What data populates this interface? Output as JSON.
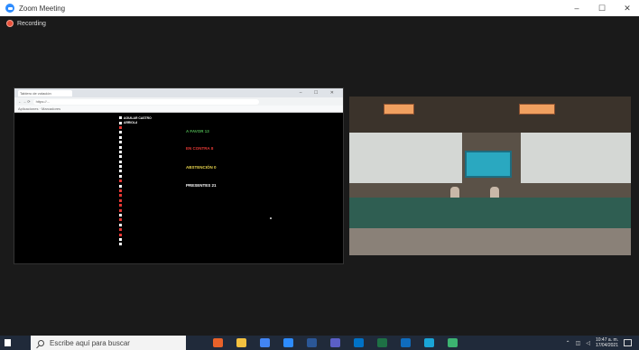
{
  "window": {
    "title": "Zoom Meeting",
    "controls": [
      "–",
      "☐",
      "✕"
    ]
  },
  "recording": {
    "label": "Recording"
  },
  "share": {
    "tab_label": "Tablero de votación",
    "address": "https://...",
    "bookmarks": "Aplicaciones  ·  Marcadores",
    "names": [
      {
        "text": "AGUILAR CASTRO",
        "color": "#ffffff"
      },
      {
        "text": "ARRIOLA",
        "color": "#ffffff"
      },
      {
        "text": "",
        "color": "#e53935"
      },
      {
        "text": "",
        "color": "#ffffff"
      },
      {
        "text": "",
        "color": "#ffffff"
      },
      {
        "text": "",
        "color": "#ffffff"
      },
      {
        "text": "",
        "color": "#ffffff"
      },
      {
        "text": "",
        "color": "#ffffff"
      },
      {
        "text": "",
        "color": "#ffffff"
      },
      {
        "text": "",
        "color": "#ffffff"
      },
      {
        "text": "",
        "color": "#ffffff"
      },
      {
        "text": "",
        "color": "#ffffff"
      },
      {
        "text": "",
        "color": "#ffffff"
      },
      {
        "text": "",
        "color": "#e53935"
      },
      {
        "text": "",
        "color": "#ffffff"
      },
      {
        "text": "",
        "color": "#e53935"
      },
      {
        "text": "",
        "color": "#e53935"
      },
      {
        "text": "",
        "color": "#e53935"
      },
      {
        "text": "",
        "color": "#e53935"
      },
      {
        "text": "",
        "color": "#e53935"
      },
      {
        "text": "",
        "color": "#ffffff"
      },
      {
        "text": "",
        "color": "#e53935"
      },
      {
        "text": "",
        "color": "#ffffff"
      },
      {
        "text": "",
        "color": "#e53935"
      },
      {
        "text": "",
        "color": "#e53935"
      },
      {
        "text": "",
        "color": "#ffffff"
      },
      {
        "text": "",
        "color": "#ffffff"
      }
    ],
    "tally": [
      {
        "label": "A FAVOR 13",
        "color": "#4caf50"
      },
      {
        "label": "EN CONTRA 8",
        "color": "#e53935"
      },
      {
        "label": "ABSTENCIÓN 0",
        "color": "#e8d44d"
      },
      {
        "label": "PRESENTES 21",
        "color": "#ffffff"
      }
    ]
  },
  "taskbar": {
    "search_placeholder": "Escribe aquí para buscar",
    "apps": [
      {
        "name": "firefox",
        "color": "#e8622a"
      },
      {
        "name": "file-explorer",
        "color": "#f3c140"
      },
      {
        "name": "chrome",
        "color": "#4285f4"
      },
      {
        "name": "zoom",
        "color": "#2d8cff"
      },
      {
        "name": "word",
        "color": "#2b5797"
      },
      {
        "name": "teams",
        "color": "#5b5fc7"
      },
      {
        "name": "outlook",
        "color": "#0072c6"
      },
      {
        "name": "excel",
        "color": "#1e7145"
      },
      {
        "name": "photos",
        "color": "#0f6cbd"
      },
      {
        "name": "edge",
        "color": "#1aa5d6"
      },
      {
        "name": "app-green",
        "color": "#3cb371"
      }
    ],
    "time": "10:47 a. m.",
    "date": "17/04/2021"
  }
}
